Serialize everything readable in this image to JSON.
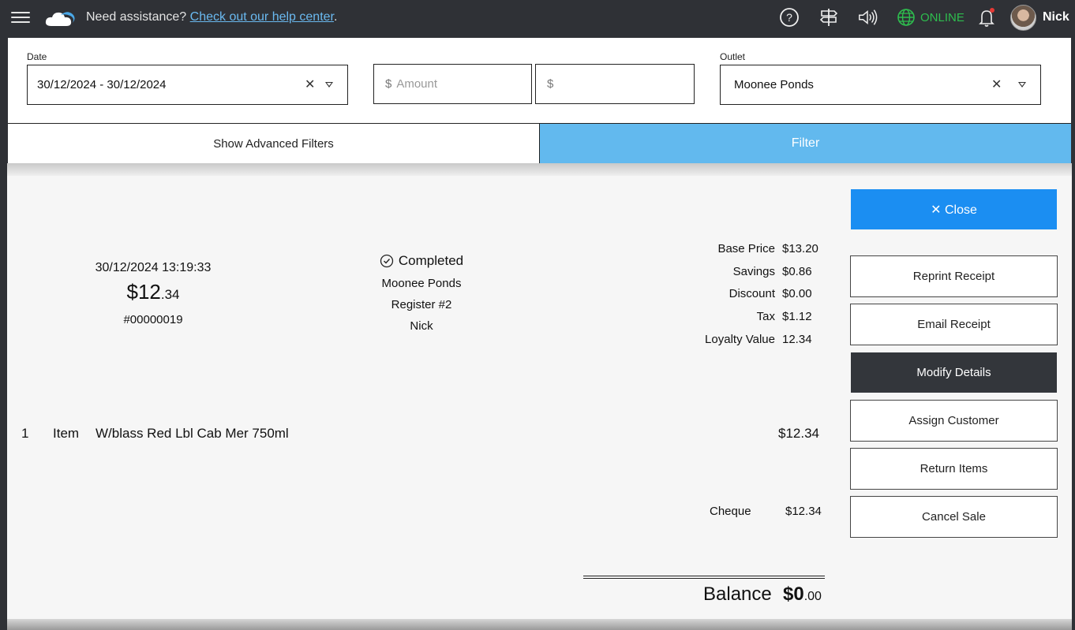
{
  "topbar": {
    "assist_text": "Need assistance? ",
    "help_link": "Check out our help center",
    "assist_suffix": ".",
    "online_label": "ONLINE",
    "username": "Nick",
    "icons": [
      "menu-icon",
      "cloud-logo",
      "help-icon",
      "signpost-icon",
      "speaker-icon",
      "globe-icon",
      "bell-icon"
    ],
    "online_color": "#2ebd4e",
    "notification_dot_color": "#e53935"
  },
  "filters": {
    "date_label": "Date",
    "date_value": "30/12/2024 - 30/12/2024",
    "amount_currency": "$",
    "amount_min_placeholder": "Amount",
    "amount_max_value": "",
    "outlet_label": "Outlet",
    "outlet_value": "Moonee Ponds",
    "advanced_label": "Show Advanced Filters",
    "filter_label": "Filter",
    "filter_color": "#62b9ee"
  },
  "sale": {
    "datetime": "30/12/2024 13:19:33",
    "total_major": "$12",
    "total_minor": ".34",
    "number": "#00000019",
    "status": "Completed",
    "outlet": "Moonee Ponds",
    "register": "Register #2",
    "staff": "Nick",
    "summary": [
      {
        "label": "Base Price",
        "value": "$13.20"
      },
      {
        "label": "Savings",
        "value": "$0.86"
      },
      {
        "label": "Discount",
        "value": "$0.00"
      },
      {
        "label": "Tax",
        "value": "$1.12"
      },
      {
        "label": "Loyalty Value",
        "value": "12.34"
      }
    ],
    "line_items": [
      {
        "qty": "1",
        "type": "Item",
        "name": "W/blass Red Lbl Cab Mer 750ml",
        "price": "$12.34"
      }
    ],
    "payments": [
      {
        "method": "Cheque",
        "amount": "$12.34"
      }
    ],
    "balance_label": "Balance",
    "balance_major": "$0",
    "balance_minor": ".00"
  },
  "actions": {
    "close": "✕ Close",
    "reprint": "Reprint Receipt",
    "email": "Email Receipt",
    "modify": "Modify Details",
    "assign": "Assign Customer",
    "return": "Return Items",
    "cancel": "Cancel Sale",
    "close_color": "#1b8ef2",
    "modify_color": "#33363b"
  }
}
